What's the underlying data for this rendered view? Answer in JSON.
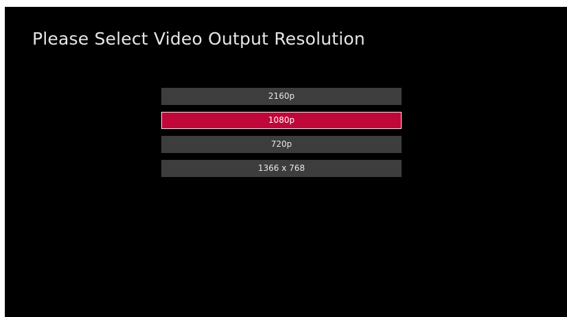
{
  "title": "Please Select Video Output Resolution",
  "options": [
    {
      "label": "2160p",
      "selected": false
    },
    {
      "label": "1080p",
      "selected": true
    },
    {
      "label": "720p",
      "selected": false
    },
    {
      "label": "1366 x 768",
      "selected": false
    }
  ],
  "colors": {
    "background": "#000000",
    "option": "#3d3d3d",
    "selected": "#c0073a",
    "text": "#e6e6e6"
  }
}
